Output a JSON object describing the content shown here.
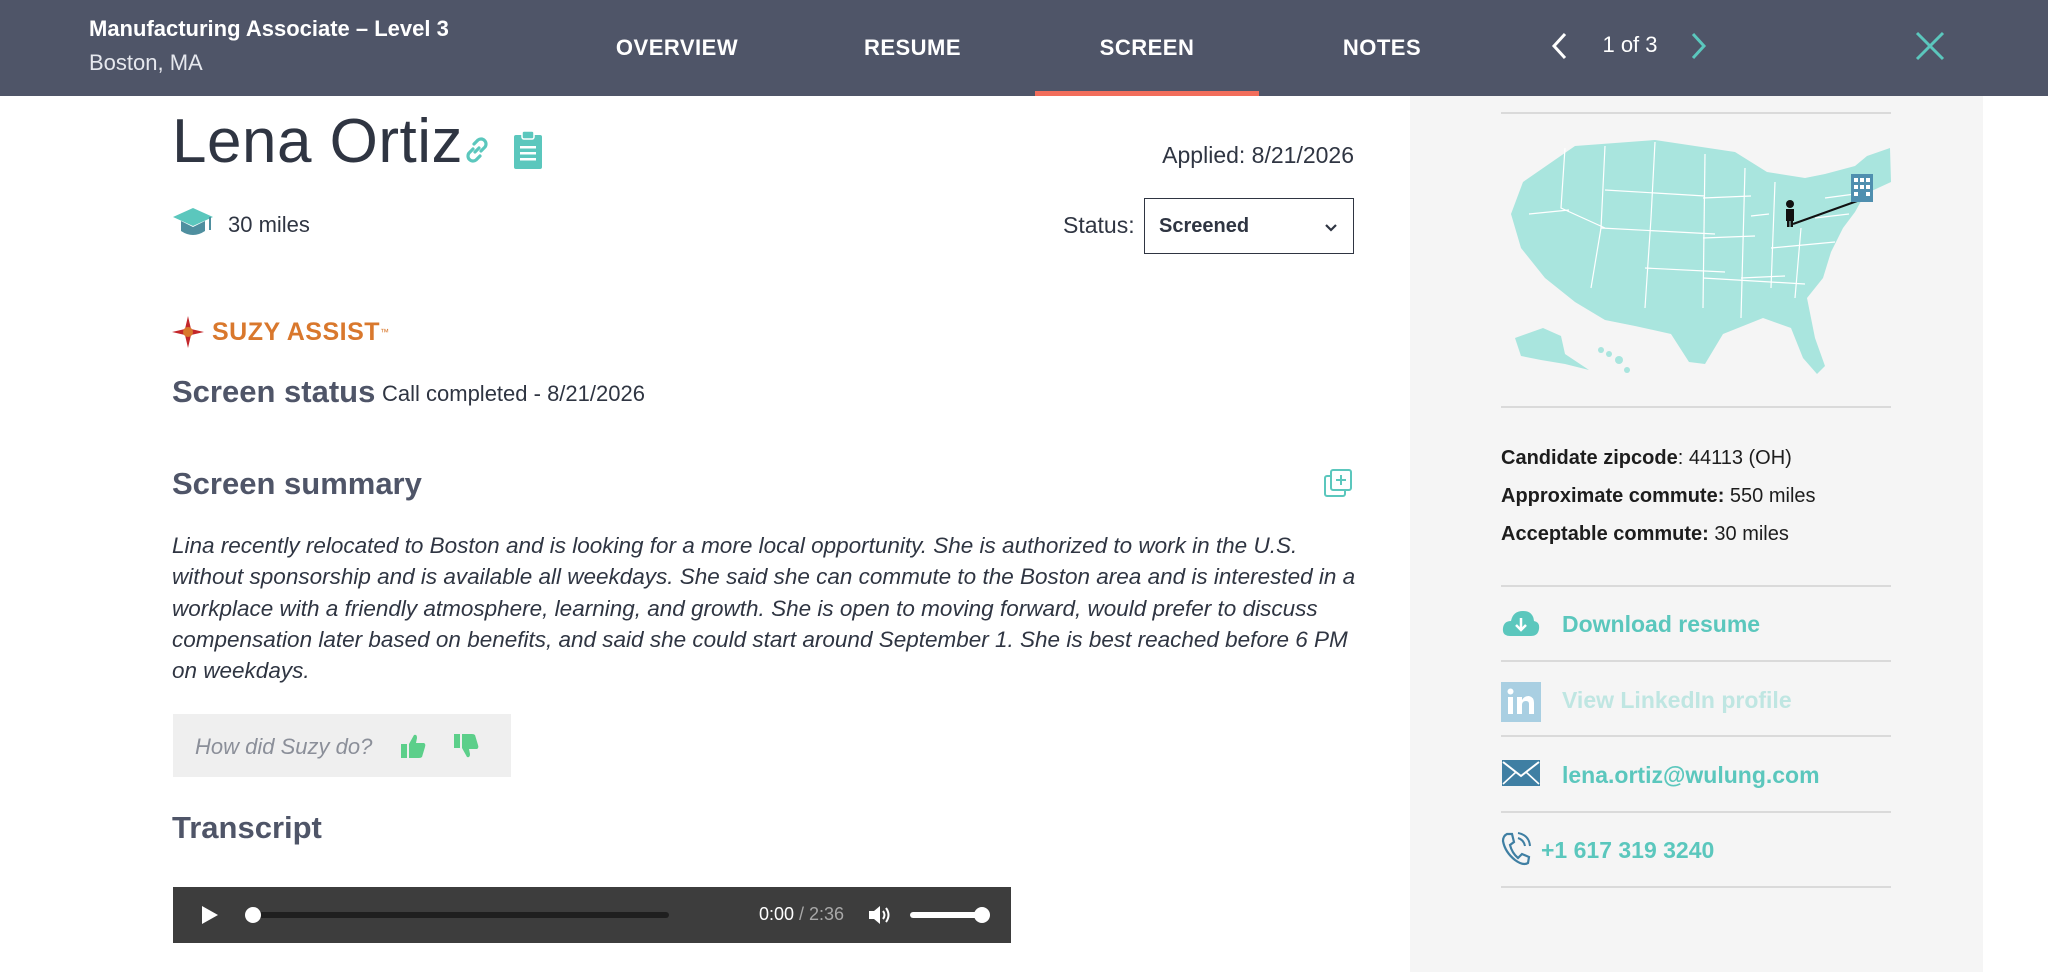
{
  "header": {
    "job_title": "Manufacturing Associate – Level 3",
    "job_location": "Boston, MA",
    "tabs": [
      {
        "label": "OVERVIEW",
        "active": false
      },
      {
        "label": "RESUME",
        "active": false
      },
      {
        "label": "SCREEN",
        "active": true
      },
      {
        "label": "NOTES",
        "active": false
      }
    ],
    "pager": "1 of 3",
    "accent_color": "#f26d5b",
    "bar_color": "#4f5568"
  },
  "candidate": {
    "name": "Lena Ortiz",
    "applied": "Applied: 8/21/2026",
    "distance": "30 miles",
    "status_label": "Status:",
    "status_value": "Screened"
  },
  "screen": {
    "logo_text": "SUZY ASSIST",
    "logo_tm": "™",
    "status_heading": "Screen status",
    "status_value": "Call completed - 8/21/2026",
    "summary_heading": "Screen summary",
    "summary": "Lina recently relocated to Boston and is looking for a more local opportunity. She is authorized to work in the U.S. without sponsorship and is available all weekdays. She said she can commute to the Boston area and is interested in a workplace with a friendly atmosphere, learning, and growth. She is open to moving forward, would prefer to discuss compensation later based on benefits, and said she could start around September 1. She is best reached before 6 PM on weekdays.",
    "feedback_prompt": "How did Suzy do?",
    "transcript_heading": "Transcript"
  },
  "player": {
    "current_time": "0:00",
    "duration_text": "/ 2:36",
    "progress": 0.0,
    "volume": 1.0
  },
  "sidebar": {
    "zip_label": "Candidate zipcode",
    "zip_value": ": 44113 (OH)",
    "commute_label": "Approximate commute:",
    "commute_value": " 550 miles",
    "accept_label": "Acceptable commute:",
    "accept_value": " 30 miles",
    "download": "Download resume",
    "linkedin": "View LinkedIn profile",
    "email": "lena.ortiz@wulung.com",
    "phone": "+1 617 319 3240",
    "link_color": "#5bc7bd"
  }
}
